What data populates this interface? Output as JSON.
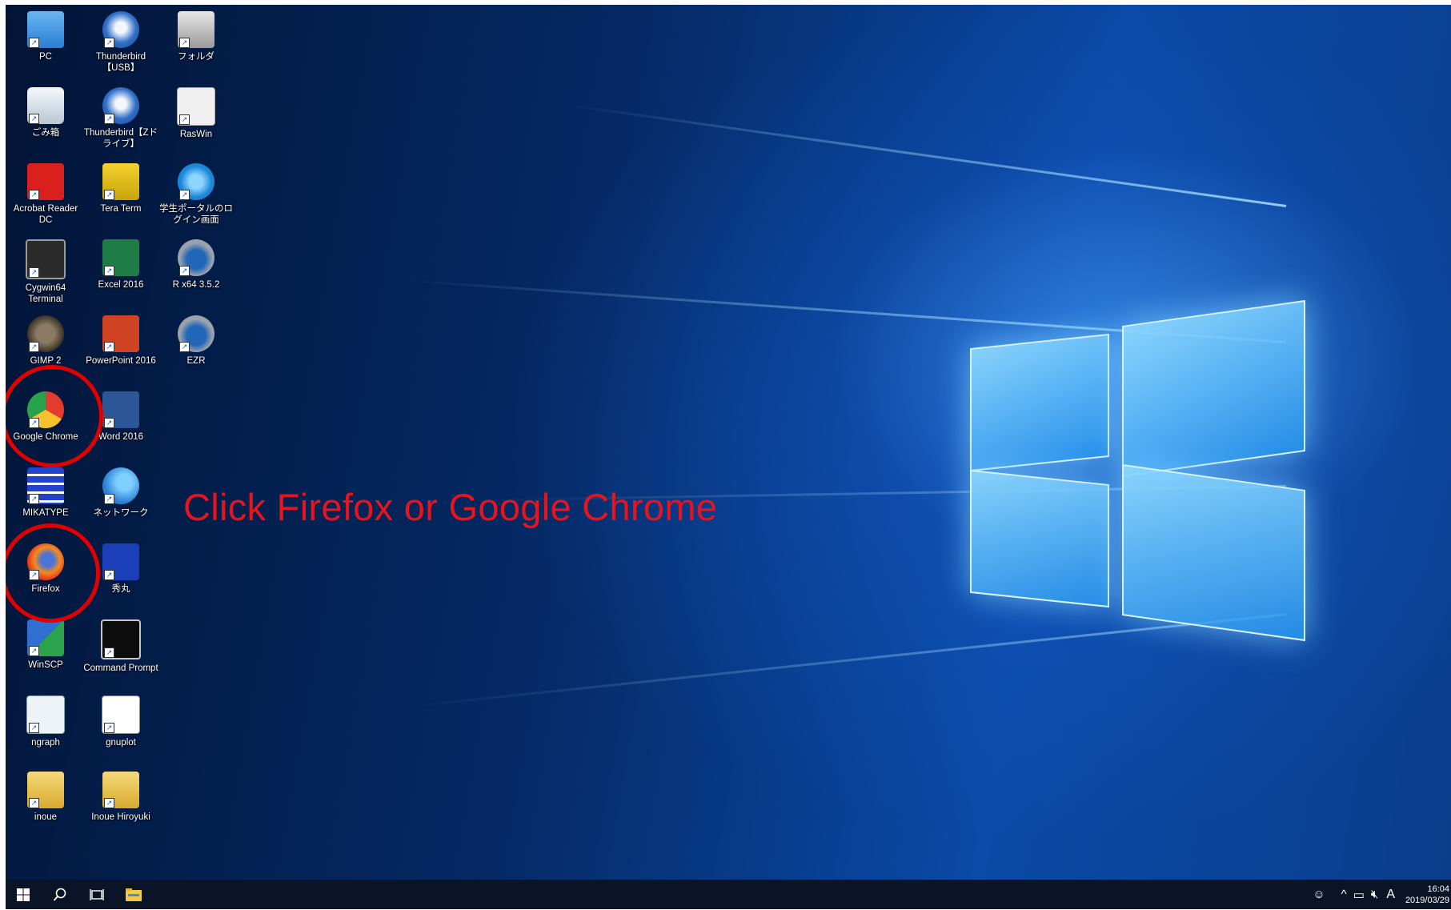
{
  "instruction": "Click Firefox or Google Chrome",
  "desktop_icons": [
    {
      "label": "PC",
      "icon": "computer-icon"
    },
    {
      "label": "Thunderbird【USB】",
      "icon": "thunderbird-icon"
    },
    {
      "label": "フォルダ",
      "icon": "folder-drive-icon"
    },
    {
      "label": "ごみ箱",
      "icon": "recycle-bin-icon"
    },
    {
      "label": "Thunderbird【Zドライブ】",
      "icon": "thunderbird-icon"
    },
    {
      "label": "RasWin",
      "icon": "raswin-icon"
    },
    {
      "label": "Acrobat Reader DC",
      "icon": "acrobat-icon"
    },
    {
      "label": "Tera Term",
      "icon": "teraterm-icon"
    },
    {
      "label": "学生ポータルのログイン画面",
      "icon": "internet-explorer-icon"
    },
    {
      "label": "Cygwin64 Terminal",
      "icon": "cygwin-icon"
    },
    {
      "label": "Excel 2016",
      "icon": "excel-icon"
    },
    {
      "label": "R x64 3.5.2",
      "icon": "r-icon"
    },
    {
      "label": "GIMP 2",
      "icon": "gimp-icon"
    },
    {
      "label": "PowerPoint 2016",
      "icon": "powerpoint-icon"
    },
    {
      "label": "EZR",
      "icon": "r-icon"
    },
    {
      "label": "Google Chrome",
      "icon": "chrome-icon"
    },
    {
      "label": "Word 2016",
      "icon": "word-icon"
    },
    {
      "label": "MIKATYPE",
      "icon": "mikatype-icon"
    },
    {
      "label": "ネットワーク",
      "icon": "network-icon"
    },
    {
      "label": "Firefox",
      "icon": "firefox-icon"
    },
    {
      "label": "秀丸",
      "icon": "hidemaru-icon"
    },
    {
      "label": "WinSCP",
      "icon": "winscp-icon"
    },
    {
      "label": "Command Prompt",
      "icon": "command-prompt-icon"
    },
    {
      "label": "ngraph",
      "icon": "ngraph-icon"
    },
    {
      "label": "gnuplot",
      "icon": "gnuplot-icon"
    },
    {
      "label": "inoue",
      "icon": "user-folder-icon"
    },
    {
      "label": "Inoue Hiroyuki",
      "icon": "user-folder-icon"
    }
  ],
  "taskbar": {
    "start": "start-icon",
    "search": "search-icon",
    "task_view": "task-view-icon",
    "explorer": "file-explorer-icon",
    "tray": {
      "people": "people-icon",
      "chevron": "^",
      "network": "network-tray-icon",
      "volume": "volume-muted-icon",
      "ime": "A"
    },
    "time": "16:04",
    "date": "2019/03/29"
  },
  "colors": {
    "annotation_red": "#e00000",
    "taskbar": "#0b1426",
    "desktop_blue": "#0a4aa8"
  }
}
